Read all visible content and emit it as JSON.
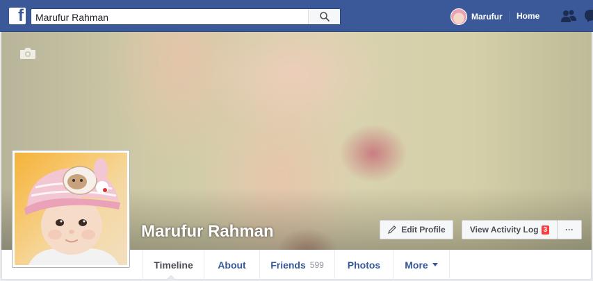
{
  "topbar": {
    "search_value": "Marufur Rahman",
    "user_name": "Marufur",
    "home_label": "Home",
    "brand_color": "#3b5998"
  },
  "profile": {
    "name": "Marufur Rahman",
    "edit_profile_label": "Edit Profile",
    "view_activity_log_label": "View Activity Log",
    "activity_badge": "3",
    "more_button_label": "···"
  },
  "tabs": {
    "timeline": "Timeline",
    "about": "About",
    "friends": "Friends",
    "friends_count": "599",
    "photos": "Photos",
    "more": "More"
  },
  "icons": [
    "facebook-logo-icon",
    "search-icon",
    "friends-icon",
    "messenger-icon",
    "camera-icon",
    "pencil-icon",
    "caret-down-icon"
  ]
}
